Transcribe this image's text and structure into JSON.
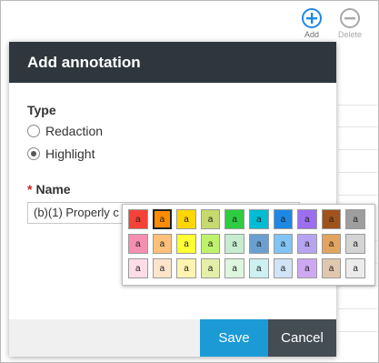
{
  "toolbar": {
    "add_label": "Add",
    "delete_label": "Delete",
    "add_icon": "plus-icon",
    "delete_icon": "minus-icon",
    "add_color": "#1e88e5"
  },
  "modal": {
    "title": "Add annotation",
    "type_label": "Type",
    "type_options": [
      "Redaction",
      "Highlight"
    ],
    "type_selected": "Highlight",
    "name_required": "*",
    "name_label": "Name",
    "name_value": "(b)(1) Properly c"
  },
  "footer": {
    "save_label": "Save",
    "cancel_label": "Cancel",
    "save_color": "#1b9ad6",
    "cancel_color": "#444c54"
  },
  "palette": {
    "swatch_text": "a",
    "selected": "#ff8c00",
    "rows": [
      [
        "#f44336",
        "#ff8c00",
        "#ffd600",
        "#c5d96e",
        "#2ecc40",
        "#00bcd4",
        "#1e88e5",
        "#9c6ef0",
        "#a0521b",
        "#9e9e9e"
      ],
      [
        "#f48fb1",
        "#ffc07a",
        "#ffff33",
        "#bff26b",
        "#c8ecd0",
        "#6a9fd1",
        "#80c5f5",
        "#b6a4f0",
        "#e2a45e",
        "#d4d4d4"
      ],
      [
        "#fcdde8",
        "#fde5cc",
        "#fff5b0",
        "#e4f0a8",
        "#ddf6dd",
        "#cdf0f0",
        "#d0e4f5",
        "#cfa8f2",
        "#e0c8b0",
        "#ececec"
      ]
    ]
  }
}
